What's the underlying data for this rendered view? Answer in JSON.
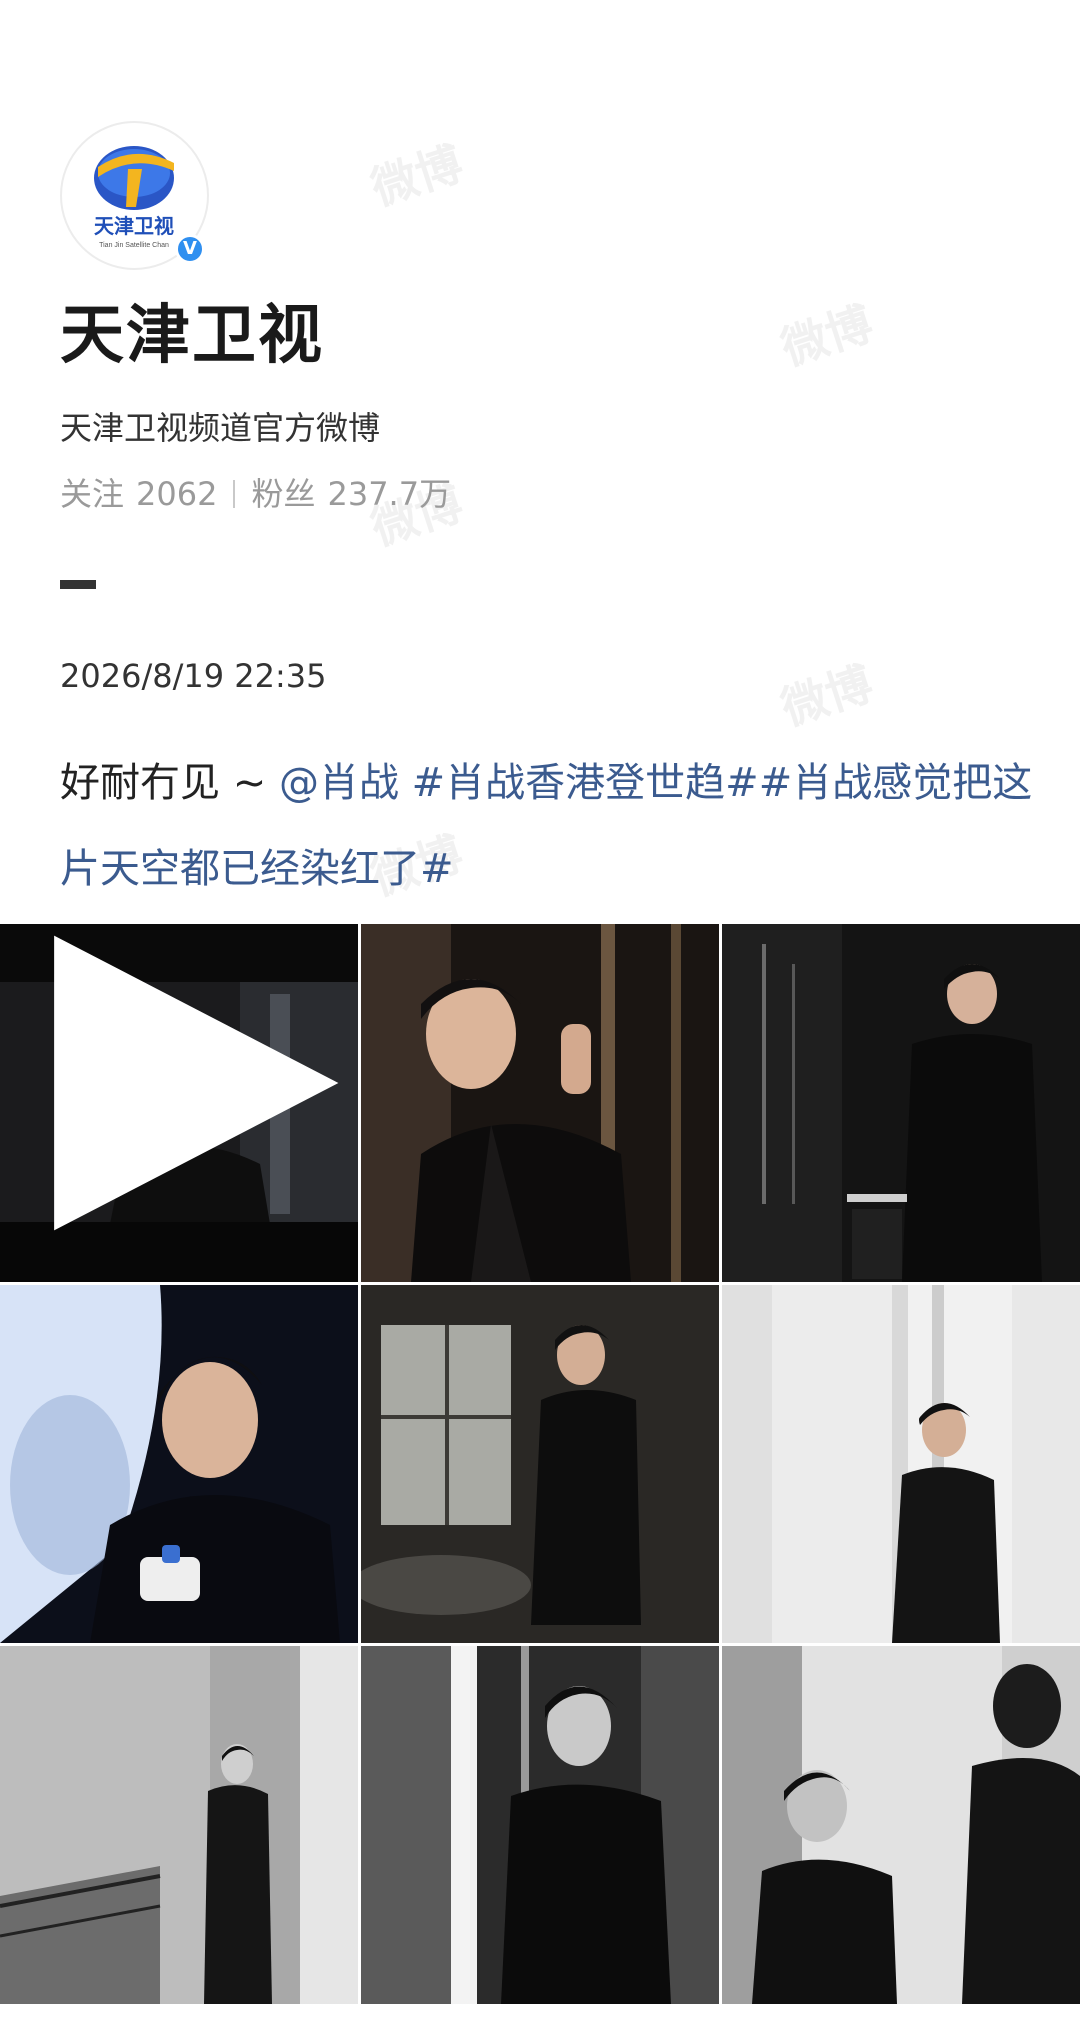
{
  "account": {
    "name": "天津卫视",
    "bio": "天津卫视频道官方微博",
    "following_label": "关注",
    "following_count": "2062",
    "followers_label": "粉丝",
    "followers_count": "237.7万",
    "avatar_logo_text": "天津卫视",
    "avatar_logo_subtext": "Tian Jin Satellite Chan",
    "verified_mark": "V"
  },
  "post": {
    "date": "2026/8/19 22:35",
    "text": "好耐冇见 ~ ",
    "mention": "@肖战",
    "tag1": " #肖战香港登世趋#",
    "tag2": "#肖战感觉把这片天空都已经染红了#"
  },
  "watermark": "微博",
  "photos": [
    {
      "label": "photo-1",
      "has_play": true
    },
    {
      "label": "photo-2",
      "has_play": false
    },
    {
      "label": "photo-3",
      "has_play": false
    },
    {
      "label": "photo-4",
      "has_play": false
    },
    {
      "label": "photo-5",
      "has_play": false
    },
    {
      "label": "photo-6",
      "has_play": false
    },
    {
      "label": "photo-7",
      "has_play": false
    },
    {
      "label": "photo-8",
      "has_play": false
    },
    {
      "label": "photo-9",
      "has_play": false
    }
  ]
}
